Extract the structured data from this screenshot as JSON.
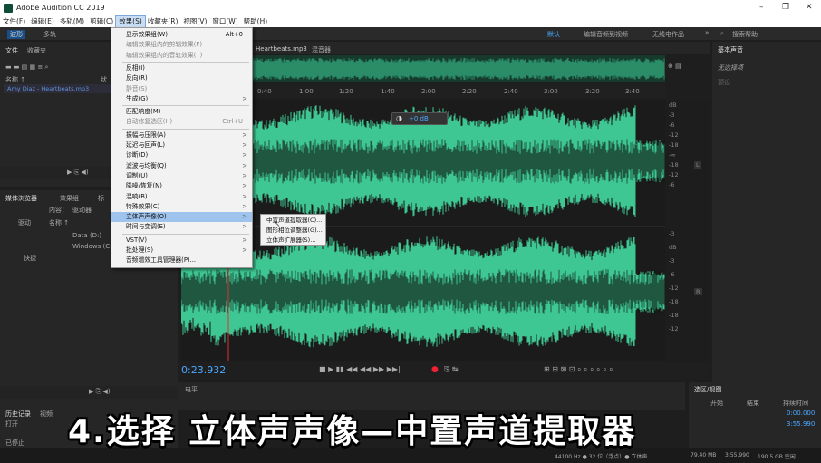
{
  "window": {
    "title": "Adobe Audition CC 2019",
    "controls": [
      "–",
      "❐",
      "✕"
    ]
  },
  "menubar": {
    "items": [
      "文件(F)",
      "编辑(E)",
      "多轨(M)",
      "剪辑(C)",
      "效果(S)",
      "收藏夹(R)",
      "视图(V)",
      "窗口(W)",
      "帮助(H)"
    ],
    "selected": 4
  },
  "toolbar": {
    "wave_label": "波形",
    "multi_label": "多轨",
    "workspace_default": "默认",
    "ws_edit_video": "编辑音频到视频",
    "ws_radio": "无线电作品",
    "more": "»",
    "search_placeholder": "搜索帮助"
  },
  "files_panel": {
    "tab_files": "文件",
    "tab_fav": "收藏夹",
    "col_name": "名称 ↑",
    "col_status": "状",
    "file_name": "Amy Diaz - Heartbeats.mp3"
  },
  "media_panel": {
    "tab_media": "媒体浏览器",
    "tab_effects": "效果组",
    "tab_mark": "标",
    "col_content": "内容：",
    "col_drive": "驱动器",
    "col_name2": "名称 ↑",
    "drive_label": "驱动",
    "drive_d": "Data (D:)",
    "drive_c": "Windows (C:)",
    "shortcut_label": "快捷"
  },
  "history_panel": {
    "tab_history": "历史记录",
    "tab_video": "视频",
    "item_open": "打开",
    "status": "已停止"
  },
  "editor": {
    "tab_file": "Heartbeats.mp3",
    "tab_mixer": "混音器",
    "hud_db": "+0 dB"
  },
  "ruler": {
    "ticks": [
      "0:40",
      "1:00",
      "1:20",
      "1:40",
      "2:00",
      "2:20",
      "2:40",
      "3:00",
      "3:20",
      "3:40"
    ]
  },
  "db_scale": {
    "top": [
      "dB",
      "-3",
      "-6",
      "-12",
      "-18",
      "-∞",
      "-18",
      "-12",
      "-6"
    ],
    "bottom": [
      "-3",
      "dB",
      "-3",
      "-6",
      "-12",
      "-18",
      "-18",
      "-12"
    ],
    "ch_l": "L",
    "ch_r": "R"
  },
  "transport": {
    "timecode": "0:23.932"
  },
  "right_panel": {
    "title": "基本声音",
    "item": "无选择项",
    "sub": "预设"
  },
  "level_panel": {
    "title": "电平"
  },
  "selection_panel": {
    "title": "选区/视图",
    "col_start": "开始",
    "col_end": "结束",
    "col_dur": "持续时间",
    "val_start": "0:00.000",
    "val_dur": "3:55.990"
  },
  "statusbar": {
    "sample": "44100 Hz ● 32 位（浮点）● 立体声",
    "size": "79.40 MB",
    "dur": "3:55.990",
    "free": "190.5 GB 空闲"
  },
  "effects_menu": {
    "items": [
      {
        "label": "显示效果组(W)",
        "shortcut": "Alt+0",
        "arrow": "",
        "disabled": false
      },
      {
        "label": "编辑效果组内的剪辑效果(F)",
        "shortcut": "",
        "arrow": "",
        "disabled": true
      },
      {
        "label": "编辑效果组内的音轨效果(T)",
        "shortcut": "",
        "arrow": "",
        "disabled": true
      },
      {
        "label": "反相(I)",
        "shortcut": "",
        "arrow": "",
        "disabled": false
      },
      {
        "label": "反向(R)",
        "shortcut": "",
        "arrow": "",
        "disabled": false
      },
      {
        "label": "静音(S)",
        "shortcut": "",
        "arrow": "",
        "disabled": true
      },
      {
        "label": "生成(G)",
        "shortcut": "",
        "arrow": ">",
        "disabled": false
      },
      {
        "label": "匹配响度(M)",
        "shortcut": "",
        "arrow": "",
        "disabled": false
      },
      {
        "label": "自动修复选区(H)",
        "shortcut": "Ctrl+U",
        "arrow": "",
        "disabled": true
      },
      {
        "label": "振幅与压限(A)",
        "shortcut": "",
        "arrow": ">",
        "disabled": false
      },
      {
        "label": "延迟与回声(L)",
        "shortcut": "",
        "arrow": ">",
        "disabled": false
      },
      {
        "label": "诊断(D)",
        "shortcut": "",
        "arrow": ">",
        "disabled": false
      },
      {
        "label": "滤波与均衡(Q)",
        "shortcut": "",
        "arrow": ">",
        "disabled": false
      },
      {
        "label": "调制(U)",
        "shortcut": "",
        "arrow": ">",
        "disabled": false
      },
      {
        "label": "降噪/恢复(N)",
        "shortcut": "",
        "arrow": ">",
        "disabled": false
      },
      {
        "label": "混响(B)",
        "shortcut": "",
        "arrow": ">",
        "disabled": false
      },
      {
        "label": "特殊效果(C)",
        "shortcut": "",
        "arrow": ">",
        "disabled": false
      },
      {
        "label": "立体声声像(O)",
        "shortcut": "",
        "arrow": ">",
        "disabled": false
      },
      {
        "label": "时间与变调(E)",
        "shortcut": "",
        "arrow": ">",
        "disabled": false
      },
      {
        "label": "VST(V)",
        "shortcut": "",
        "arrow": ">",
        "disabled": false
      },
      {
        "label": "批处理(S)",
        "shortcut": "",
        "arrow": ">",
        "disabled": false
      },
      {
        "label": "音频增效工具管理器(P)...",
        "shortcut": "",
        "arrow": "",
        "disabled": false
      }
    ],
    "highlighted": 17
  },
  "submenu": {
    "items": [
      "中置声道提取器(C)...",
      "图形相位调整器(G)...",
      "立体声扩展器(S)..."
    ]
  },
  "caption": "4.选择 立体声声像—中置声道提取器",
  "colors": {
    "wave": "#3ec792",
    "wave_dark": "#2a8d68",
    "accent": "#4aa8ff"
  }
}
